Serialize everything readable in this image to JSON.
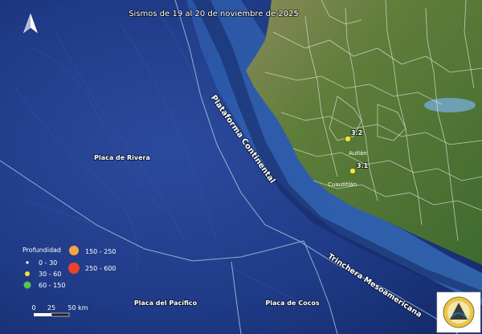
{
  "map": {
    "title": "Sismos de 19 al 20 de noviembre de 2025",
    "plates": {
      "rivera": "Placa de Rivera",
      "pacifico": "Placa del Pacífico",
      "cocos": "Placa de Cocos"
    },
    "features": {
      "shelf": "Plataforma Continental",
      "trench": "Trinchera Mesoamericana"
    },
    "towns": {
      "autlan": "Autlán",
      "cuautitlan": "Cuautitlán"
    },
    "quakes": [
      {
        "magnitude": "3.2",
        "depth_class": "30 - 60",
        "color": "#f2e72c"
      },
      {
        "magnitude": "3.1",
        "depth_class": "30 - 60",
        "color": "#f2e72c"
      }
    ],
    "legend": {
      "title": "Profundidad",
      "items": [
        {
          "label": "0 - 30",
          "color": "#ffffff"
        },
        {
          "label": "30 - 60",
          "color": "#f2e72c"
        },
        {
          "label": "60 - 150",
          "color": "#5ec24f"
        },
        {
          "label": "150 - 250",
          "color": "#f4a640"
        },
        {
          "label": "250 - 600",
          "color": "#e8442b"
        }
      ]
    },
    "scale": {
      "ticks": [
        "0",
        "25",
        "50 km"
      ]
    },
    "north_arrow": "north-arrow-icon",
    "colors": {
      "ocean": "#1d3a8a",
      "land": "#5c7a3c",
      "boundary": "#9ec7d8",
      "trench_line": "#7fb0c8"
    }
  }
}
